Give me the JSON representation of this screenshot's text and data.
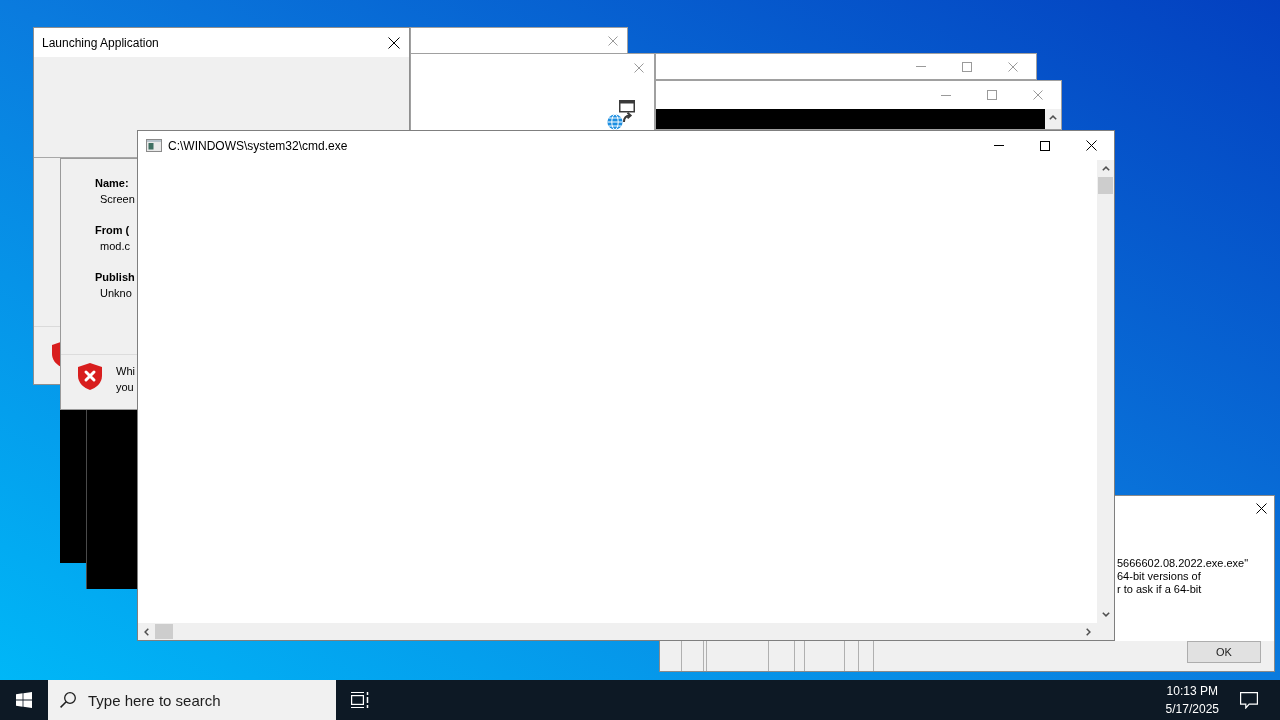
{
  "launching_dialog": {
    "title": "Launching Application",
    "active": true
  },
  "windows": [
    {
      "kind": "dialog",
      "active": false
    },
    {
      "kind": "dialog",
      "active": false
    },
    {
      "kind": "app",
      "active": false
    },
    {
      "kind": "console",
      "active": false
    }
  ],
  "cmd_window": {
    "title": "C:\\WINDOWS\\system32\\cmd.exe",
    "active": true
  },
  "security_dialog": {
    "fields": [
      {
        "label": "Name:",
        "value": "Screen"
      },
      {
        "label": "From (",
        "value": "mod.c"
      },
      {
        "label": "Publish",
        "value": "Unkno"
      }
    ],
    "warning_lines": [
      "Whi",
      "you"
    ]
  },
  "message_dialog": {
    "lines": [
      "5666602.08.2022.exe.exe\"",
      "64-bit versions of",
      "r to ask if a 64-bit"
    ],
    "button": "OK"
  },
  "taskbar": {
    "search": {
      "placeholder": "Type here to search"
    },
    "clock": {
      "time": "10:13 PM",
      "date": "5/17/2025"
    }
  }
}
